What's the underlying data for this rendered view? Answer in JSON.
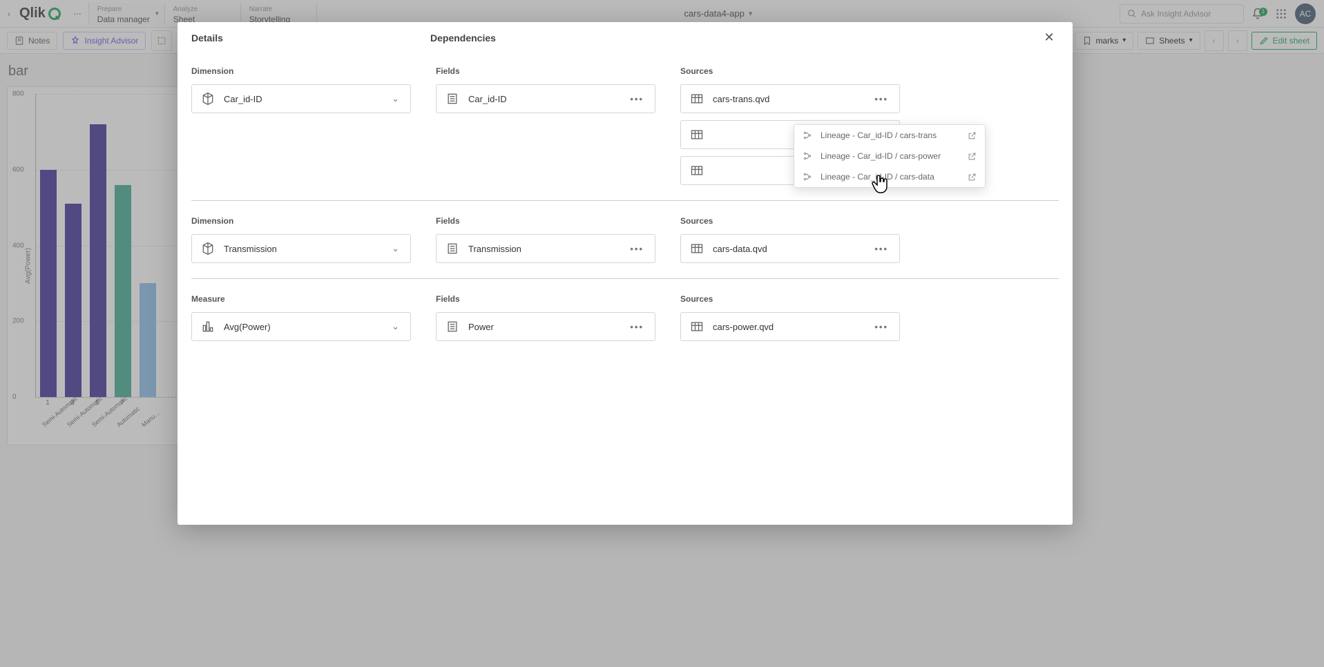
{
  "topbar": {
    "logo_text": "Qlik",
    "tabs": [
      {
        "small": "Prepare",
        "main": "Data manager",
        "active": true,
        "caret": true
      },
      {
        "small": "Analyze",
        "main": "Sheet",
        "active": false,
        "caret": false
      },
      {
        "small": "Narrate",
        "main": "Storytelling",
        "active": false,
        "caret": false
      }
    ],
    "app_title": "cars-data4-app",
    "search_placeholder": "Ask Insight Advisor",
    "bell_count": "1",
    "avatar_initials": "AC"
  },
  "toolbar": {
    "notes_label": "Notes",
    "insight_label": "Insight Advisor",
    "bookmarks_label": "marks",
    "sheets_label": "Sheets",
    "edit_label": "Edit sheet"
  },
  "sheet": {
    "title": "bar",
    "ylabel": "Avg(Power)"
  },
  "chart_data": {
    "type": "bar",
    "categories": [
      "1",
      "3",
      "5",
      "7",
      ""
    ],
    "category_names": [
      "Semi-Automatic",
      "Semi-Automatic",
      "Semi-Automatic",
      "Automatic",
      "Manu…"
    ],
    "values": [
      600,
      510,
      720,
      560,
      300
    ],
    "series2_values": [
      0,
      0,
      0,
      0,
      300
    ],
    "colors": [
      "#2b1a8b",
      "#2b1a8b",
      "#2b1a8b",
      "#2aa184",
      "#7eb6e6"
    ],
    "ylabel": "Avg(Power)",
    "ylim": [
      0,
      800
    ],
    "yticks": [
      0,
      200,
      400,
      600,
      800
    ]
  },
  "modal": {
    "details_label": "Details",
    "dependencies_label": "Dependencies",
    "close": "✕",
    "rows": [
      {
        "left_label": "Dimension",
        "left_item": "Car_id-ID",
        "fields_label": "Fields",
        "fields_items": [
          "Car_id-ID"
        ],
        "sources_label": "Sources",
        "sources_items": [
          "cars-trans.qvd",
          "",
          ""
        ]
      },
      {
        "left_label": "Dimension",
        "left_item": "Transmission",
        "fields_label": "Fields",
        "fields_items": [
          "Transmission"
        ],
        "sources_label": "Sources",
        "sources_items": [
          "cars-data.qvd"
        ]
      },
      {
        "left_label": "Measure",
        "left_item": "Avg(Power)",
        "fields_label": "Fields",
        "fields_items": [
          "Power"
        ],
        "sources_label": "Sources",
        "sources_items": [
          "cars-power.qvd"
        ]
      }
    ]
  },
  "lineage_menu": {
    "items": [
      "Lineage - Car_id-ID / cars-trans",
      "Lineage - Car_id-ID / cars-power",
      "Lineage - Car_id-ID / cars-data"
    ]
  }
}
